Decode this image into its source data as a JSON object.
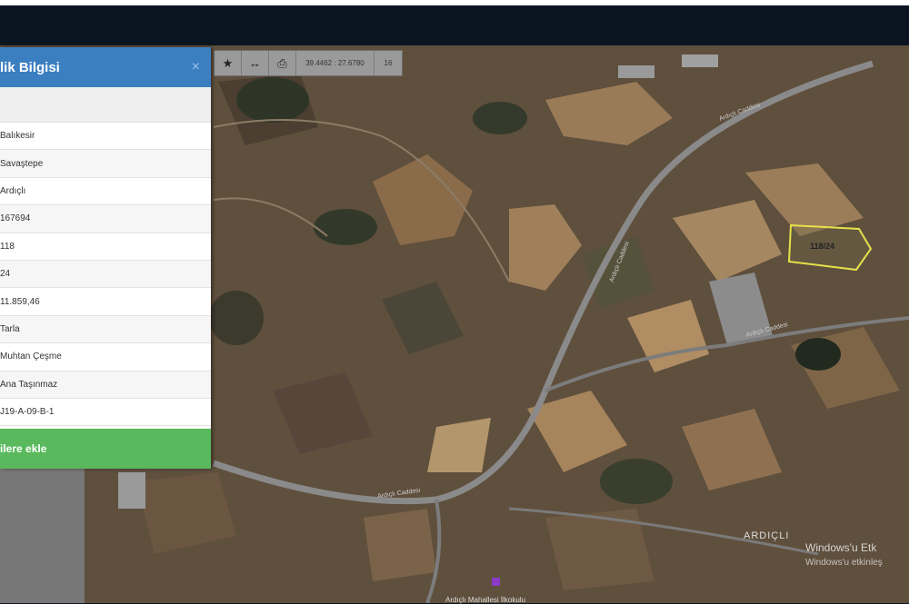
{
  "panel": {
    "title": "lik Bilgisi",
    "close_label": "×",
    "rows": [
      "Balıkesir",
      "Savaştepe",
      "Ardıçlı",
      "167694",
      "118",
      "24",
      "11.859,46",
      "Tarla",
      "Muhtan Çeşme",
      "Ana Taşınmaz",
      "J19-A-09-B-1"
    ],
    "button_label": "ilere ekle"
  },
  "toolbar": {
    "favorite_icon": "★",
    "measure_icon": "↔",
    "print_icon": "⎙",
    "coordinates": "39.4462 : 27.6780",
    "zoom": "16"
  },
  "map": {
    "parcel_label": "118/24",
    "town_label": "ARDIÇLI",
    "school_label": "Ardıçlı Mahallesi İlkokulu",
    "road_labels": [
      "Ardıçlı Caddesi",
      "Ardıçlı Caddesi",
      "Ardıçlı Caddesi",
      "Ardıçlı Caddesi"
    ]
  },
  "watermark": {
    "line1": "Windows'u Etk",
    "line2": "Windows'u etkinleş"
  },
  "colors": {
    "header_blue": "#3c7fc1",
    "button_green": "#59b95c",
    "parcel_outline": "#e6e04a"
  }
}
